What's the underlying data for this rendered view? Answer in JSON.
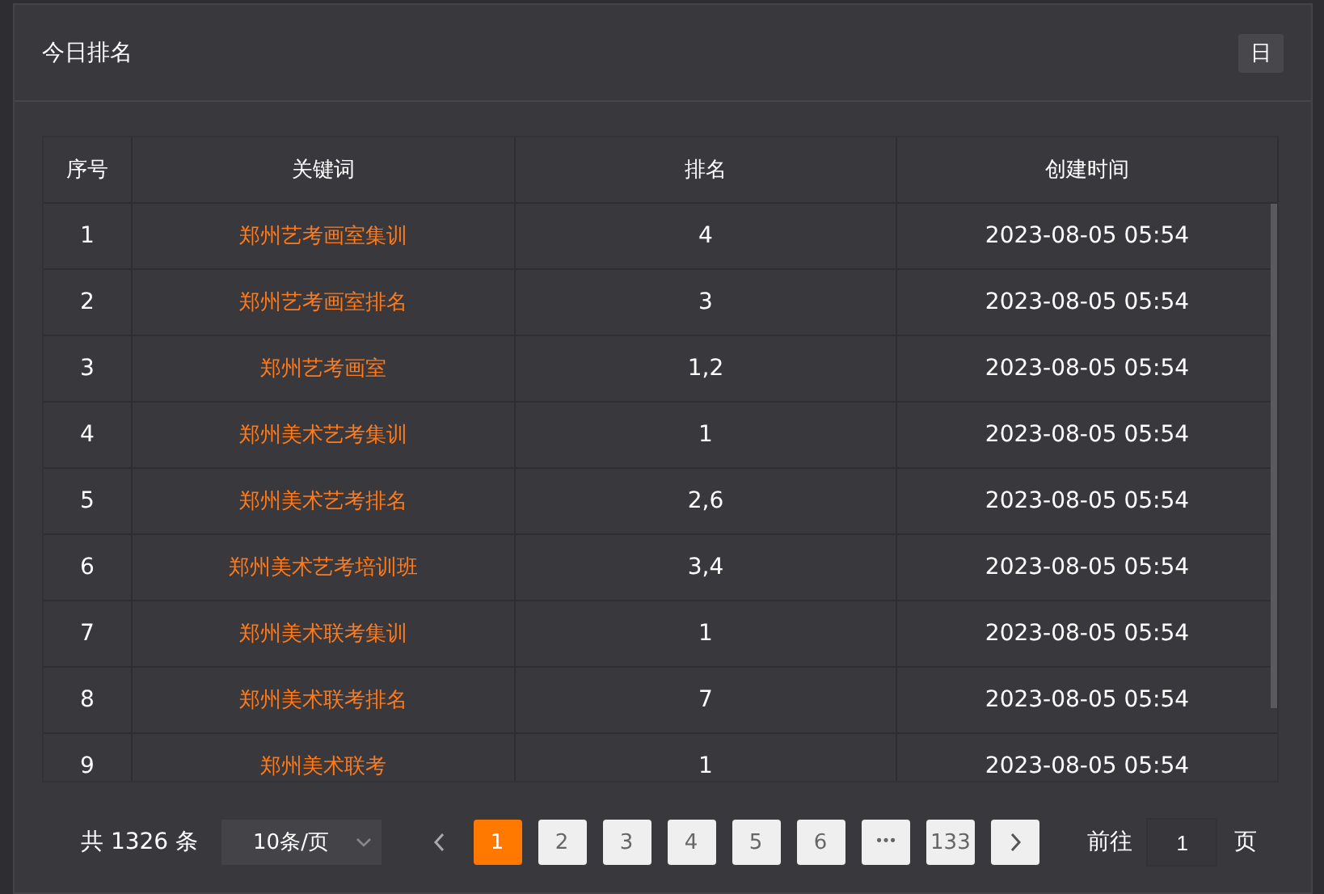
{
  "card": {
    "title": "今日排名",
    "period_button": "日"
  },
  "table": {
    "columns": [
      "序号",
      "关键词",
      "排名",
      "创建时间"
    ],
    "rows": [
      [
        "1",
        "郑州艺考画室集训",
        "4",
        "2023-08-05 05:54"
      ],
      [
        "2",
        "郑州艺考画室排名",
        "3",
        "2023-08-05 05:54"
      ],
      [
        "3",
        "郑州艺考画室",
        "1,2",
        "2023-08-05 05:54"
      ],
      [
        "4",
        "郑州美术艺考集训",
        "1",
        "2023-08-05 05:54"
      ],
      [
        "5",
        "郑州美术艺考排名",
        "2,6",
        "2023-08-05 05:54"
      ],
      [
        "6",
        "郑州美术艺考培训班",
        "3,4",
        "2023-08-05 05:54"
      ],
      [
        "7",
        "郑州美术联考集训",
        "1",
        "2023-08-05 05:54"
      ],
      [
        "8",
        "郑州美术联考排名",
        "7",
        "2023-08-05 05:54"
      ],
      [
        "9",
        "郑州美术联考",
        "1",
        "2023-08-05 05:54"
      ]
    ]
  },
  "pagination": {
    "total": "共 1326 条",
    "page_size": "10条/页",
    "pages": [
      {
        "kind": "page",
        "label": "1",
        "selected": true
      },
      {
        "kind": "page",
        "label": "2",
        "selected": false
      },
      {
        "kind": "page",
        "label": "3",
        "selected": false
      },
      {
        "kind": "page",
        "label": "4",
        "selected": false
      },
      {
        "kind": "page",
        "label": "5",
        "selected": false
      },
      {
        "kind": "page",
        "label": "6",
        "selected": false
      },
      {
        "kind": "ellipsis",
        "label": "•••",
        "selected": false
      },
      {
        "kind": "page",
        "label": "133",
        "selected": false
      }
    ],
    "goto_label": "前往",
    "goto_value": "1",
    "goto_suffix": "页"
  }
}
